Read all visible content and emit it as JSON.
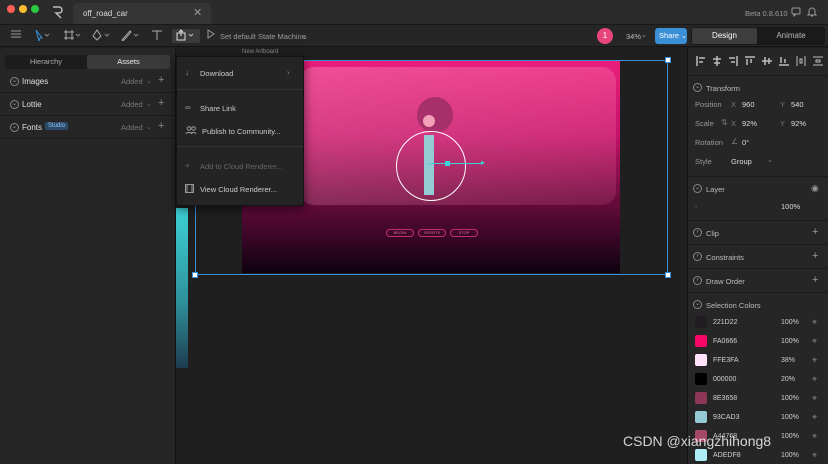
{
  "window": {
    "tab_title": "off_road_car",
    "tab_close": "✕",
    "version": "Beta 0.8.610"
  },
  "toolbar": {
    "state_machine": "Set default State Machine",
    "notification_count": "1",
    "zoom": "34%",
    "share_label": "Share",
    "mode_design": "Design",
    "mode_animate": "Animate"
  },
  "left_panel": {
    "tab_hierarchy": "Hierarchy",
    "tab_assets": "Assets",
    "rows": [
      {
        "label": "Images",
        "status": "Added"
      },
      {
        "label": "Lottie",
        "status": "Added"
      },
      {
        "label": "Fonts",
        "badge": "Studio",
        "status": "Added"
      }
    ]
  },
  "canvas": {
    "artboard_label": "New Artboard",
    "buttons": [
      "BEGIN",
      "SPORTS",
      "STOP"
    ]
  },
  "share_menu": {
    "items": [
      {
        "icon": "download-icon",
        "label": "Download",
        "enabled": true
      },
      {
        "icon": "link-icon",
        "label": "Share Link",
        "enabled": true
      },
      {
        "icon": "community-icon",
        "label": "Publish to Community...",
        "enabled": true
      },
      {
        "icon": "add-icon",
        "label": "Add to Cloud Renderer...",
        "enabled": false
      },
      {
        "icon": "film-icon",
        "label": "View Cloud Renderer...",
        "enabled": true
      }
    ]
  },
  "transform": {
    "title": "Transform",
    "position_label": "Position",
    "pos_x_label": "X",
    "pos_x": "960",
    "pos_y_label": "Y",
    "pos_y": "540",
    "scale_label": "Scale",
    "scale_x_label": "X",
    "scale_x": "92%",
    "scale_y_label": "Y",
    "scale_y": "92%",
    "rotation_label": "Rotation",
    "rotation": "0°",
    "style_label": "Style",
    "style_value": "Group"
  },
  "layer": {
    "title": "Layer",
    "dash": "-",
    "opacity": "100%"
  },
  "sections": {
    "clip": "Clip",
    "constraints": "Constraints",
    "draw_order": "Draw Order",
    "selection_colors": "Selection Colors"
  },
  "selection_colors": [
    {
      "hex": "221D22",
      "opacity": "100%",
      "color": "#221D22"
    },
    {
      "hex": "FA0666",
      "opacity": "100%",
      "color": "#FA0666"
    },
    {
      "hex": "FFE3FA",
      "opacity": "38%",
      "color": "#FFE3FA"
    },
    {
      "hex": "000000",
      "opacity": "20%",
      "color": "#000000"
    },
    {
      "hex": "8E3658",
      "opacity": "100%",
      "color": "#8E3658"
    },
    {
      "hex": "93CAD3",
      "opacity": "100%",
      "color": "#93CAD3"
    },
    {
      "hex": "A44768",
      "opacity": "100%",
      "color": "#A44768"
    },
    {
      "hex": "ADEDF8",
      "opacity": "100%",
      "color": "#ADEDF8"
    }
  ],
  "watermark": "CSDN @xiangzhihong8",
  "colors": {
    "accent": "#3a8fd6",
    "badge": "#e8457d",
    "artboard_top": "#e91e7a",
    "artboard_bottom": "#0e0210"
  }
}
